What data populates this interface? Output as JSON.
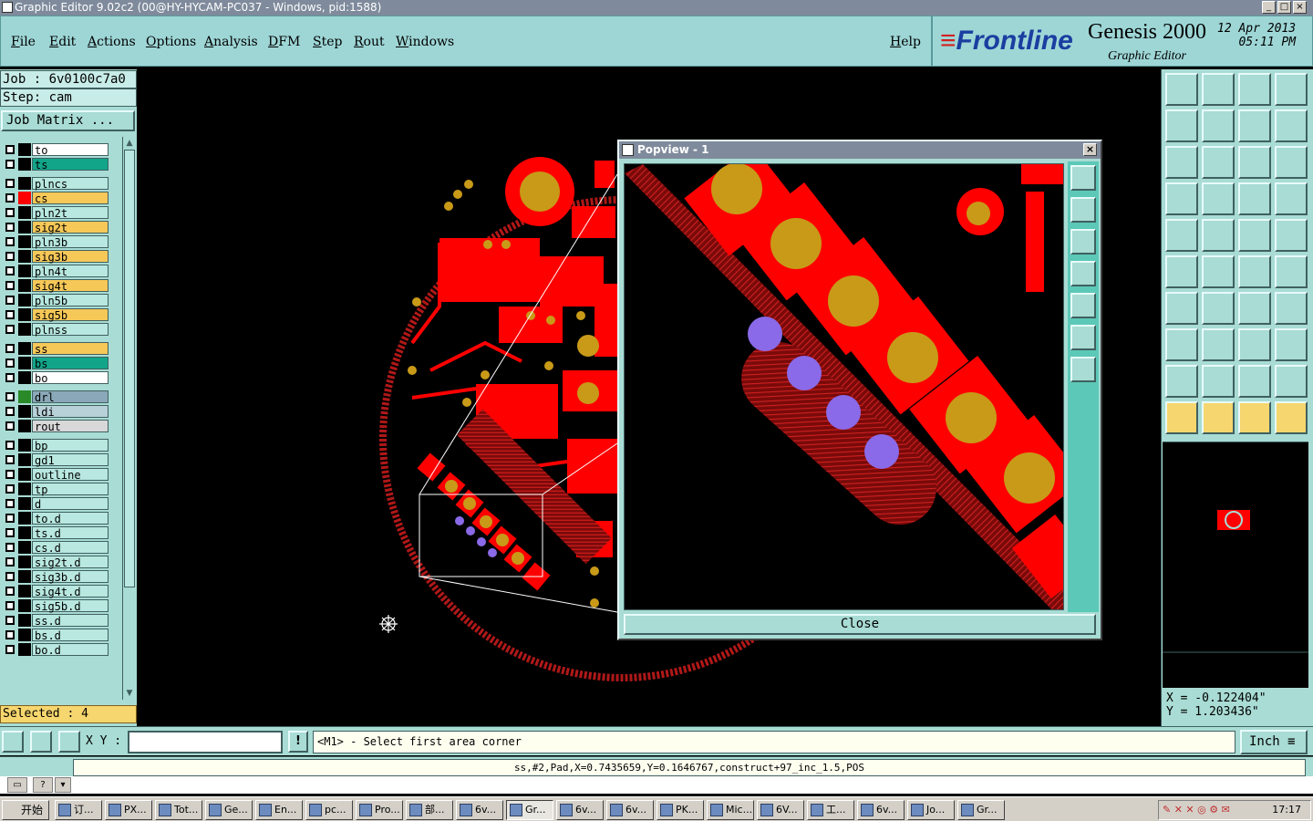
{
  "window": {
    "title": "Graphic Editor 9.02c2 (00@HY-HYCAM-PC037 - Windows, pid:1588)"
  },
  "menu": [
    "File",
    "Edit",
    "Actions",
    "Options",
    "Analysis",
    "DFM",
    "Step",
    "Rout",
    "Windows"
  ],
  "help_label": "Help",
  "brand": {
    "logo": "Frontline",
    "product": "Genesis 2000",
    "module": "Graphic Editor",
    "date": "12 Apr 2013",
    "time": "05:11 PM"
  },
  "job": {
    "job_label": "Job : 6v0100c7a0",
    "step_label": "Step: cam",
    "matrix_button": "Job Matrix ..."
  },
  "layers": [
    {
      "name": "to",
      "color": "#ffffff",
      "swatch": "#000000"
    },
    {
      "name": "ts",
      "color": "#12a58a",
      "swatch": "#000000"
    },
    {
      "name": "plncs",
      "color": "#b8e8e0",
      "swatch": "#000000",
      "gap": true
    },
    {
      "name": "cs",
      "color": "#f6c858",
      "swatch": "#ff0000"
    },
    {
      "name": "pln2t",
      "color": "#b8e8e0",
      "swatch": "#000000"
    },
    {
      "name": "sig2t",
      "color": "#f6c858",
      "swatch": "#000000"
    },
    {
      "name": "pln3b",
      "color": "#b8e8e0",
      "swatch": "#000000"
    },
    {
      "name": "sig3b",
      "color": "#f6c858",
      "swatch": "#000000"
    },
    {
      "name": "pln4t",
      "color": "#b8e8e0",
      "swatch": "#000000"
    },
    {
      "name": "sig4t",
      "color": "#f6c858",
      "swatch": "#000000"
    },
    {
      "name": "pln5b",
      "color": "#b8e8e0",
      "swatch": "#000000"
    },
    {
      "name": "sig5b",
      "color": "#f6c858",
      "swatch": "#000000"
    },
    {
      "name": "plnss",
      "color": "#b8e8e0",
      "swatch": "#000000"
    },
    {
      "name": "ss",
      "color": "#f6c858",
      "swatch": "#000000",
      "gap": true
    },
    {
      "name": "bs",
      "color": "#12a58a",
      "swatch": "#000000"
    },
    {
      "name": "bo",
      "color": "#ffffff",
      "swatch": "#000000"
    },
    {
      "name": "drl",
      "color": "#8aa8b8",
      "swatch": "#2a8a2a",
      "gap": true
    },
    {
      "name": "ldi",
      "color": "#b8d0d8",
      "swatch": "#000000"
    },
    {
      "name": "rout",
      "color": "#d8d8d8",
      "swatch": "#000000"
    },
    {
      "name": "bp",
      "color": "#b8e8e0",
      "swatch": "#000000",
      "gap": true
    },
    {
      "name": "gd1",
      "color": "#b8e8e0",
      "swatch": "#000000"
    },
    {
      "name": "outline",
      "color": "#b8e8e0",
      "swatch": "#000000"
    },
    {
      "name": "tp",
      "color": "#b8e8e0",
      "swatch": "#000000"
    },
    {
      "name": "d",
      "color": "#b8e8e0",
      "swatch": "#000000"
    },
    {
      "name": "to.d",
      "color": "#b8e8e0",
      "swatch": "#000000"
    },
    {
      "name": "ts.d",
      "color": "#b8e8e0",
      "swatch": "#000000"
    },
    {
      "name": "cs.d",
      "color": "#b8e8e0",
      "swatch": "#000000"
    },
    {
      "name": "sig2t.d",
      "color": "#b8e8e0",
      "swatch": "#000000"
    },
    {
      "name": "sig3b.d",
      "color": "#b8e8e0",
      "swatch": "#000000"
    },
    {
      "name": "sig4t.d",
      "color": "#b8e8e0",
      "swatch": "#000000"
    },
    {
      "name": "sig5b.d",
      "color": "#b8e8e0",
      "swatch": "#000000"
    },
    {
      "name": "ss.d",
      "color": "#b8e8e0",
      "swatch": "#000000"
    },
    {
      "name": "bs.d",
      "color": "#b8e8e0",
      "swatch": "#000000"
    },
    {
      "name": "bo.d",
      "color": "#b8e8e0",
      "swatch": "#000000"
    }
  ],
  "selected_label": "Selected : 4",
  "popview": {
    "title": "Popview - 1",
    "close_label": "Close"
  },
  "coords": {
    "x": "X = -0.122404\"",
    "y": "Y = 1.203436\""
  },
  "command": {
    "xy_label": "X Y :",
    "xy_value": "",
    "prompt": "<M1> - Select first area corner",
    "unit": "Inch"
  },
  "status_text": "ss,#2,Pad,X=0.7435659,Y=0.1646767,construct+97_inc_1.5,POS",
  "taskbar": {
    "start": "开始",
    "tasks": [
      "订...",
      "PX...",
      "Tot...",
      "Ge...",
      "En...",
      "pc...",
      "Pro...",
      "部...",
      "6v...",
      "Gr...",
      "6v...",
      "6v...",
      "PK...",
      "Mic...",
      "6V...",
      "工...",
      "6v...",
      "Jo...",
      "Gr..."
    ],
    "clock": "17:17"
  },
  "colors": {
    "panel": "#a8dcd4",
    "copper": "#ff0000",
    "pad_gold": "#c89a18",
    "via_purple": "#8a6ae8",
    "accent_yellow": "#f6d66e"
  }
}
